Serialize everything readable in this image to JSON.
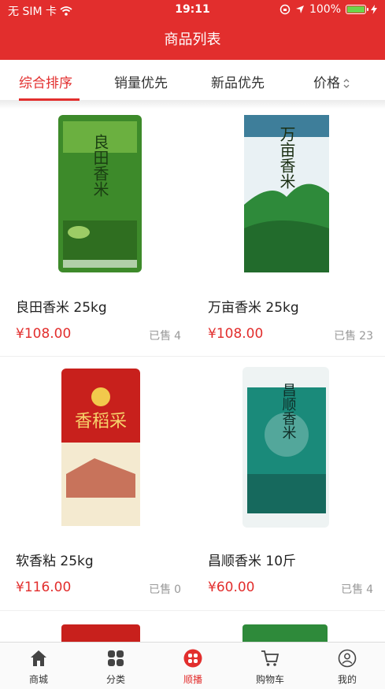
{
  "status_bar": {
    "carrier": "无 SIM 卡",
    "time": "19:11",
    "battery_percent": "100%",
    "battery_level": 1.0
  },
  "nav": {
    "title": "商品列表"
  },
  "sort_tabs": [
    {
      "label": "综合排序",
      "active": true
    },
    {
      "label": "销量优先",
      "active": false
    },
    {
      "label": "新品优先",
      "active": false
    },
    {
      "label": "价格",
      "active": false
    }
  ],
  "products": [
    {
      "name": "良田香米 25kg",
      "price": "¥108.00",
      "sold_label": "已售",
      "sold_count": "4",
      "bag_color": "#3d8a2a",
      "bag_text": "良田香米"
    },
    {
      "name": "万亩香米 25kg",
      "price": "¥108.00",
      "sold_label": "已售",
      "sold_count": "23",
      "bag_color": "#1f6e8e",
      "bag_text": "万亩香米"
    },
    {
      "name": "软香粘 25kg",
      "price": "¥116.00",
      "sold_label": "已售",
      "sold_count": "0",
      "bag_color": "#c8201c",
      "bag_text": "香稻采"
    },
    {
      "name": "昌顺香米 10斤",
      "price": "¥60.00",
      "sold_label": "已售",
      "sold_count": "4",
      "bag_color": "#1a8a7a",
      "bag_text": "昌顺香米"
    }
  ],
  "tabbar": [
    {
      "label": "商城",
      "icon": "home-icon",
      "active": false
    },
    {
      "label": "分类",
      "icon": "grid-icon",
      "active": false
    },
    {
      "label": "顺播",
      "icon": "broadcast-icon",
      "active": true
    },
    {
      "label": "购物车",
      "icon": "cart-icon",
      "active": false
    },
    {
      "label": "我的",
      "icon": "user-icon",
      "active": false
    }
  ],
  "colors": {
    "accent": "#e22e2d",
    "price": "#e22e2d",
    "muted": "#999999"
  }
}
